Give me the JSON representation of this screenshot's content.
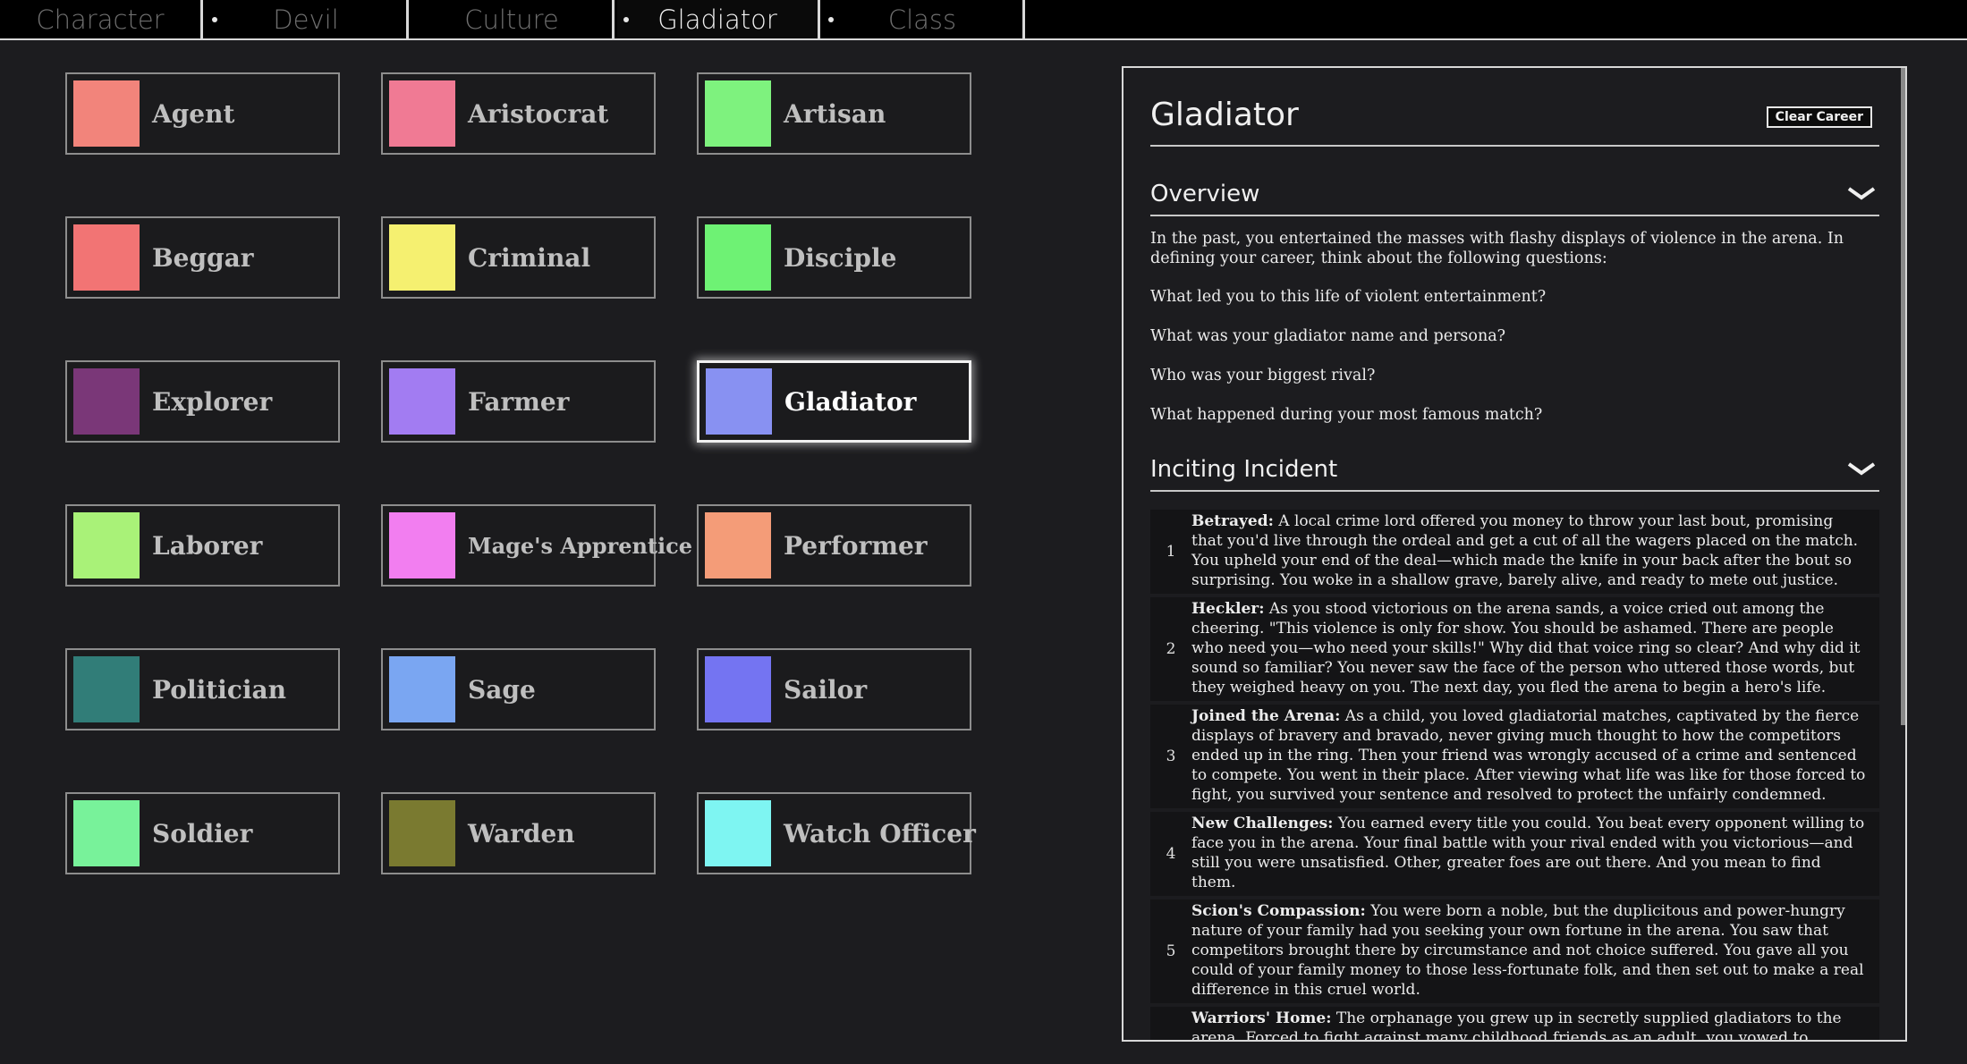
{
  "tabs": [
    {
      "label": "Character",
      "dot": false,
      "active": false
    },
    {
      "label": "Devil",
      "dot": true,
      "active": false
    },
    {
      "label": "Culture",
      "dot": false,
      "active": false
    },
    {
      "label": "Gladiator",
      "dot": true,
      "active": true
    },
    {
      "label": "Class",
      "dot": true,
      "active": false
    }
  ],
  "careers": [
    {
      "label": "Agent",
      "color": "#f2847b"
    },
    {
      "label": "Aristocrat",
      "color": "#f07a94"
    },
    {
      "label": "Artisan",
      "color": "#7ef27e"
    },
    {
      "label": "Beggar",
      "color": "#f27474"
    },
    {
      "label": "Criminal",
      "color": "#f5f070"
    },
    {
      "label": "Disciple",
      "color": "#6ef274"
    },
    {
      "label": "Explorer",
      "color": "#7a3778"
    },
    {
      "label": "Farmer",
      "color": "#a27cf2"
    },
    {
      "label": "Gladiator",
      "color": "#8891f2",
      "selected": true
    },
    {
      "label": "Laborer",
      "color": "#a9f278"
    },
    {
      "label": "Mage's Apprentice",
      "color": "#f27ef0"
    },
    {
      "label": "Performer",
      "color": "#f49c78"
    },
    {
      "label": "Politician",
      "color": "#317d78"
    },
    {
      "label": "Sage",
      "color": "#7aa6f2"
    },
    {
      "label": "Sailor",
      "color": "#7474f2"
    },
    {
      "label": "Soldier",
      "color": "#78f29a"
    },
    {
      "label": "Warden",
      "color": "#7a7a30"
    },
    {
      "label": "Watch Officer",
      "color": "#7ef5f2"
    }
  ],
  "panel": {
    "title": "Gladiator",
    "clear_label": "Clear Career",
    "overview": {
      "heading": "Overview",
      "intro": "In the past, you entertained the masses with flashy displays of violence in the arena. In defining your career, think about the following questions:",
      "questions": [
        "What led you to this life of violent entertainment?",
        "What was your gladiator name and persona?",
        "Who was your biggest rival?",
        "What happened during your most famous match?"
      ]
    },
    "inciting": {
      "heading": "Inciting Incident",
      "items": [
        {
          "num": "1",
          "title": "Betrayed:",
          "text": "A local crime lord offered you money to throw your last bout, promising that you'd live through the ordeal and get a cut of all the wagers placed on the match. You upheld your end of the deal—which made the knife in your back after the bout so surprising. You woke in a shallow grave, barely alive, and ready to mete out justice."
        },
        {
          "num": "2",
          "title": "Heckler:",
          "text": "As you stood victorious on the arena sands, a voice cried out among the cheering. \"This violence is only for show. You should be ashamed. There are people who need you—who need your skills!\" Why did that voice ring so clear? And why did it sound so familiar? You never saw the face of the person who uttered those words, but they weighed heavy on you. The next day, you fled the arena to begin a hero's life."
        },
        {
          "num": "3",
          "title": "Joined the Arena:",
          "text": "As a child, you loved gladiatorial matches, captivated by the fierce displays of bravery and bravado, never giving much thought to how the competitors ended up in the ring. Then your friend was wrongly accused of a crime and sentenced to compete. You went in their place. After viewing what life was like for those forced to fight, you survived your sentence and resolved to protect the unfairly condemned."
        },
        {
          "num": "4",
          "title": "New Challenges:",
          "text": "You earned every title you could. You beat every opponent willing to face you in the arena. Your final battle with your rival ended with you victorious—and still you were unsatisfied. Other, greater foes are out there. And you mean to find them."
        },
        {
          "num": "5",
          "title": "Scion's Compassion:",
          "text": "You were born a noble, but the duplicitous and power-hungry nature of your family had you seeking your own fortune in the arena. You saw that competitors brought there by circumstance and not choice suffered. You gave all you could of your family money to those less-fortunate folk, and then set out to make a real difference in this cruel world."
        },
        {
          "num": "6",
          "title": "Warriors' Home:",
          "text": "The orphanage you grew up in secretly supplied gladiators to the arena. Forced to fight against many childhood friends as an adult, you vowed to dismantle the arena and free other victims. You became a liberator, dedicated to ending the oppression of"
        }
      ]
    }
  }
}
